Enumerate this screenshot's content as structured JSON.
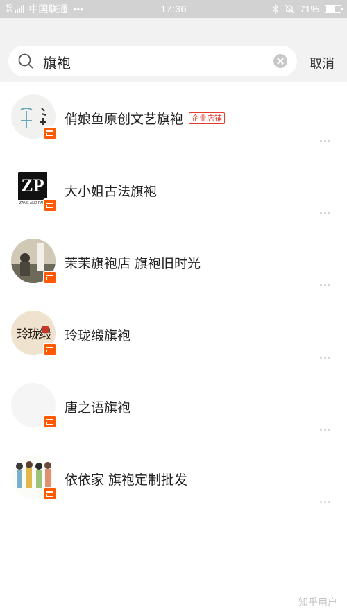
{
  "status_bar": {
    "network": "4G",
    "network_sub": "4G",
    "carrier": "中国联通",
    "dots": "•••",
    "time": "17:36",
    "battery": "71%",
    "battery_level": 0.71,
    "icons": [
      "bluetooth-icon",
      "mute-bell-icon"
    ]
  },
  "search": {
    "query": "旗袍",
    "cancel_label": "取消"
  },
  "results": [
    {
      "name": "俏娘鱼原创文艺旗袍",
      "tag": "企业店铺",
      "avatar": "ink-calligraphy"
    },
    {
      "name": "大小姐古法旗袍",
      "tag": "",
      "avatar": "zp-logo"
    },
    {
      "name": "茉茉旗袍店 旗袍旧时光",
      "tag": "",
      "avatar": "vintage-photo"
    },
    {
      "name": "玲珑缎旗袍",
      "tag": "",
      "avatar": "linglong-calligraphy"
    },
    {
      "name": "唐之语旗袍",
      "tag": "",
      "avatar": "blank"
    },
    {
      "name": "依依家 旗袍定制批发",
      "tag": "",
      "avatar": "illustrated-figures"
    }
  ],
  "zp_logo": {
    "mark": "ZP",
    "caption": "ZANG AND PARK"
  },
  "avatar4_text": "玲珑缎",
  "watermark": "知乎用户"
}
